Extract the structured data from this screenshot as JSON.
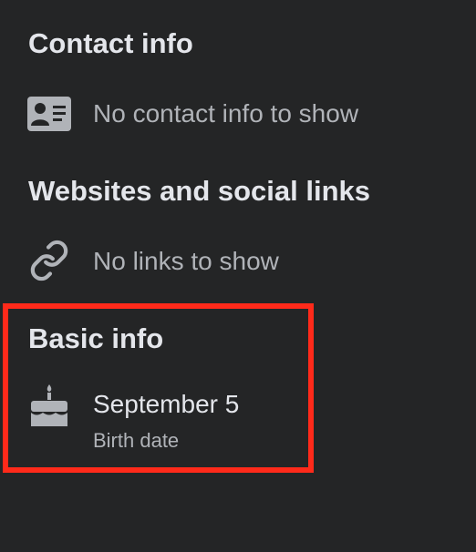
{
  "contact": {
    "title": "Contact info",
    "icon": "contact-card-icon",
    "empty_text": "No contact info to show"
  },
  "websites": {
    "title": "Websites and social links",
    "icon": "link-icon",
    "empty_text": "No links to show"
  },
  "basic": {
    "title": "Basic info",
    "icon": "birthday-cake-icon",
    "birthday_value": "September 5",
    "birthday_label": "Birth date"
  },
  "colors": {
    "background": "#242526",
    "primary_text": "#e4e6eb",
    "secondary_text": "#b0b3b8",
    "icon": "#b0b3b8",
    "highlight": "#ff2a1a"
  }
}
